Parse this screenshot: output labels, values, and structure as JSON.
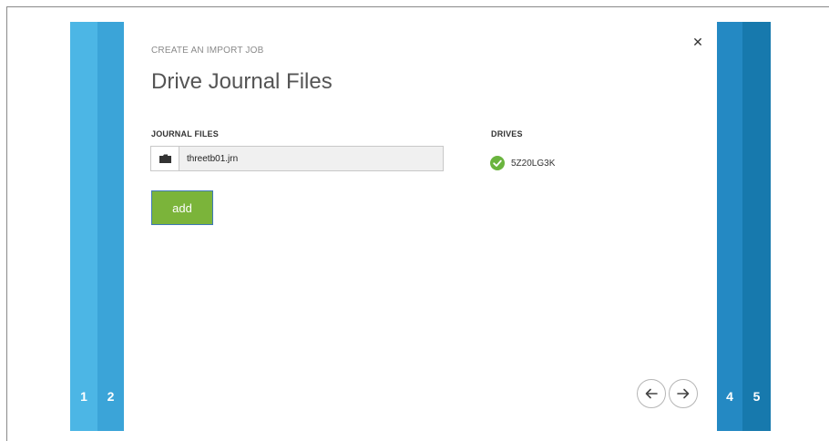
{
  "steps": {
    "left": [
      "1",
      "2"
    ],
    "right": [
      "4",
      "5"
    ]
  },
  "dialog": {
    "breadcrumb": "CREATE AN IMPORT JOB",
    "title": "Drive Journal Files",
    "close_icon": "close-icon"
  },
  "journal": {
    "label": "JOURNAL FILES",
    "file_value": "threetb01.jrn",
    "browse_icon": "folder-icon",
    "add_label": "add"
  },
  "drives": {
    "label": "DRIVES",
    "items": [
      {
        "name": "5Z20LG3K",
        "status": "verified",
        "status_icon": "check-circle-icon",
        "status_color": "#6ab43e"
      }
    ]
  },
  "navigation": {
    "prev_icon": "arrow-left-icon",
    "next_icon": "arrow-right-icon"
  },
  "colors": {
    "step1": "#4cb6e5",
    "step2": "#3ba4d8",
    "step4": "#2489c3",
    "step5": "#1779ad",
    "add_button": "#7bb43a"
  }
}
